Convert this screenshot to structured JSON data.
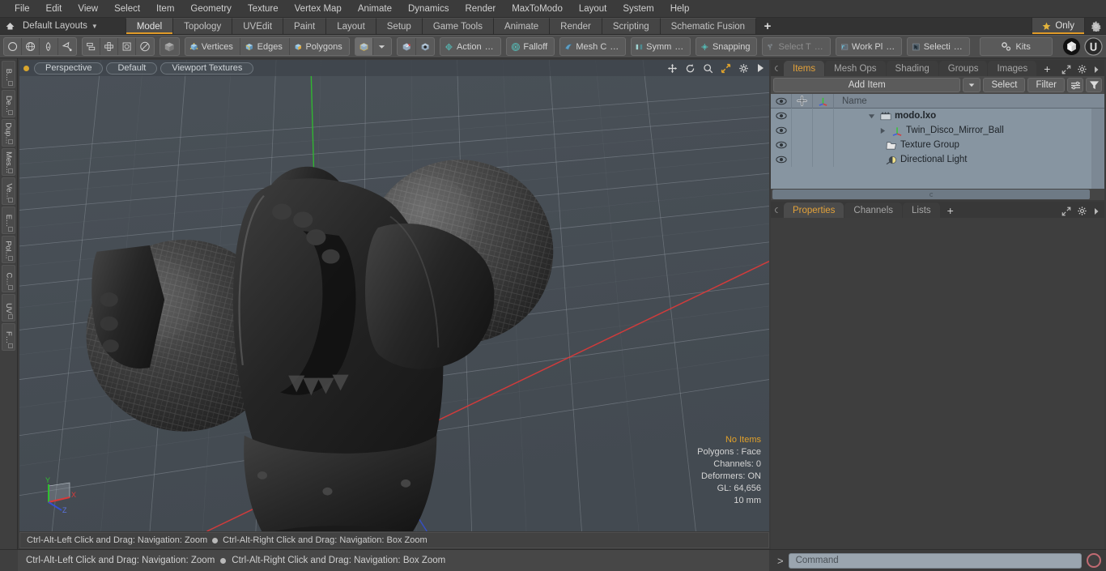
{
  "app": {
    "title": "Modo",
    "accent": "#e09a28",
    "viewport_bg": "#474e55"
  },
  "menubar": {
    "items": [
      "File",
      "Edit",
      "View",
      "Select",
      "Item",
      "Geometry",
      "Texture",
      "Vertex Map",
      "Animate",
      "Dynamics",
      "Render",
      "MaxToModo",
      "Layout",
      "System",
      "Help"
    ]
  },
  "layoutbar": {
    "layouts_label": "Default Layouts",
    "home_icon": "home-icon",
    "tabs": [
      {
        "label": "Model",
        "active": true
      },
      {
        "label": "Topology",
        "active": false
      },
      {
        "label": "UVEdit",
        "active": false
      },
      {
        "label": "Paint",
        "active": false
      },
      {
        "label": "Layout",
        "active": false
      },
      {
        "label": "Setup",
        "active": false
      },
      {
        "label": "Game Tools",
        "active": false
      },
      {
        "label": "Animate",
        "active": false
      },
      {
        "label": "Render",
        "active": false
      },
      {
        "label": "Scripting",
        "active": false
      },
      {
        "label": "Schematic Fusion",
        "active": false
      }
    ],
    "add_tab_label": "+",
    "only_label": "Only",
    "only_icon": "star-icon",
    "gear_icon": "gear-icon"
  },
  "toolbar": {
    "group_primitives": [
      {
        "icon": "circle-icon",
        "label": ""
      },
      {
        "icon": "globe-icon",
        "label": ""
      },
      {
        "icon": "pen-icon",
        "label": ""
      },
      {
        "icon": "polygon-pen-icon",
        "label": ""
      }
    ],
    "group_transform": [
      {
        "icon": "duplicate-icon",
        "label": ""
      },
      {
        "icon": "move-icon",
        "label": ""
      },
      {
        "icon": "scale-icon",
        "label": ""
      },
      {
        "icon": "rotate-icon",
        "label": ""
      }
    ],
    "group_mode": [
      {
        "icon": "cube-gray-icon",
        "label": ""
      }
    ],
    "group_components": [
      {
        "icon": "cube-vertices-icon",
        "label": "Vertices"
      },
      {
        "icon": "cube-edges-icon",
        "label": "Edges"
      },
      {
        "icon": "cube-polygons-icon",
        "label": "Polygons"
      }
    ],
    "group_items": [
      {
        "icon": "cube-items-icon",
        "label": ""
      },
      {
        "icon": "chevron-down-icon",
        "label": ""
      }
    ],
    "group_center": [
      {
        "icon": "pivot-icon",
        "label": ""
      },
      {
        "icon": "center-icon",
        "label": ""
      }
    ],
    "group_action": [
      {
        "icon": "action-center-icon",
        "label": "Action",
        "suffix": "…"
      }
    ],
    "group_falloff": [
      {
        "icon": "falloff-icon",
        "label": "Falloff"
      }
    ],
    "group_meshc": [
      {
        "icon": "mesh-constraint-icon",
        "label": "Mesh C",
        "suffix": "…"
      }
    ],
    "group_symmetry": [
      {
        "icon": "symmetry-icon",
        "label": "Symm",
        "suffix": "…"
      }
    ],
    "group_snapping": [
      {
        "icon": "snapping-icon",
        "label": "Snapping"
      }
    ],
    "group_selectthru": [
      {
        "icon": "select-through-icon",
        "label": "Select T",
        "suffix": "…",
        "disabled": true
      }
    ],
    "group_workplane": [
      {
        "icon": "work-plane-icon",
        "label": "Work Pl",
        "suffix": "…"
      }
    ],
    "group_selection": [
      {
        "icon": "selection-arrow-icon",
        "label": "Selecti",
        "suffix": "…"
      }
    ],
    "group_kits": [
      {
        "icon": "kits-gear-icon",
        "label": "Kits"
      }
    ],
    "group_engines": [
      {
        "icon": "unity-icon",
        "label": ""
      },
      {
        "icon": "unreal-icon",
        "label": ""
      }
    ]
  },
  "left_tabs": [
    "B…",
    "De…",
    "Dup…",
    "Mes…",
    "Ve…",
    "E…",
    "Pol…",
    "C…",
    "UV",
    "F…"
  ],
  "viewport": {
    "header": {
      "dot_color": "#d8a62e",
      "pills": [
        "Perspective",
        "Default",
        "Viewport Textures"
      ],
      "icons": [
        "pan-icon",
        "rotate-icon",
        "zoom-icon",
        "fit-icon",
        "gear-icon",
        "play-icon"
      ]
    },
    "stats": {
      "selection": "No Items",
      "polygons": "Polygons : Face",
      "channels": "Channels: 0",
      "deformers": "Deformers: ON",
      "gl": "GL: 64,656",
      "grid_size": "10 mm"
    },
    "gizmo": {
      "x": "X",
      "y": "Y",
      "z": "Z"
    },
    "scene_description": "Twin Disco Mirror Ball 3D model shaded dark gray on perspective grid"
  },
  "right_panel": {
    "top": {
      "tabs": [
        {
          "label": "Items",
          "active": true
        },
        {
          "label": "Mesh Ops",
          "active": false
        },
        {
          "label": "Shading",
          "active": false
        },
        {
          "label": "Groups",
          "active": false
        },
        {
          "label": "Images",
          "active": false
        }
      ],
      "add_tab_label": "+",
      "header_icons": [
        "expand-icon",
        "gear-icon",
        "chevron-right-icon"
      ],
      "toolrow": {
        "add_item_label": "Add Item",
        "dropdown_icon": "chevron-down-icon",
        "select_label": "Select",
        "filter_label": "Filter",
        "list_options_icon": "list-options-icon",
        "filter_funnel_icon": "funnel-icon"
      },
      "tree": {
        "columns": [
          "eye-icon",
          "lock-icon",
          "axis-icon",
          "Name"
        ],
        "rows": [
          {
            "name": "modo.lxo",
            "icon": "scene-clapboard-icon",
            "indent": 0,
            "expander": "down",
            "bold": true
          },
          {
            "name": "Twin_Disco_Mirror_Ball",
            "icon": "mesh-axis-icon",
            "indent": 1,
            "expander": "right",
            "bold": false
          },
          {
            "name": "Texture Group",
            "icon": "texture-group-icon",
            "indent": 1,
            "expander": "none",
            "bold": false
          },
          {
            "name": "Directional Light",
            "icon": "directional-light-icon",
            "indent": 1,
            "expander": "none",
            "bold": false
          }
        ]
      }
    },
    "bottom": {
      "tabs": [
        {
          "label": "Properties",
          "active": true
        },
        {
          "label": "Channels",
          "active": false
        },
        {
          "label": "Lists",
          "active": false
        }
      ],
      "add_tab_label": "+",
      "header_icons": [
        "expand-icon",
        "gear-icon",
        "chevron-right-icon"
      ]
    }
  },
  "statusbar": {
    "left_hint": "Ctrl-Alt-Left Click and Drag: Navigation: Zoom",
    "right_hint": "Ctrl-Alt-Right Click and Drag: Navigation: Box Zoom"
  },
  "command_line": {
    "prompt": ">",
    "placeholder": "Command",
    "value": "",
    "record_icon": "record-icon"
  }
}
